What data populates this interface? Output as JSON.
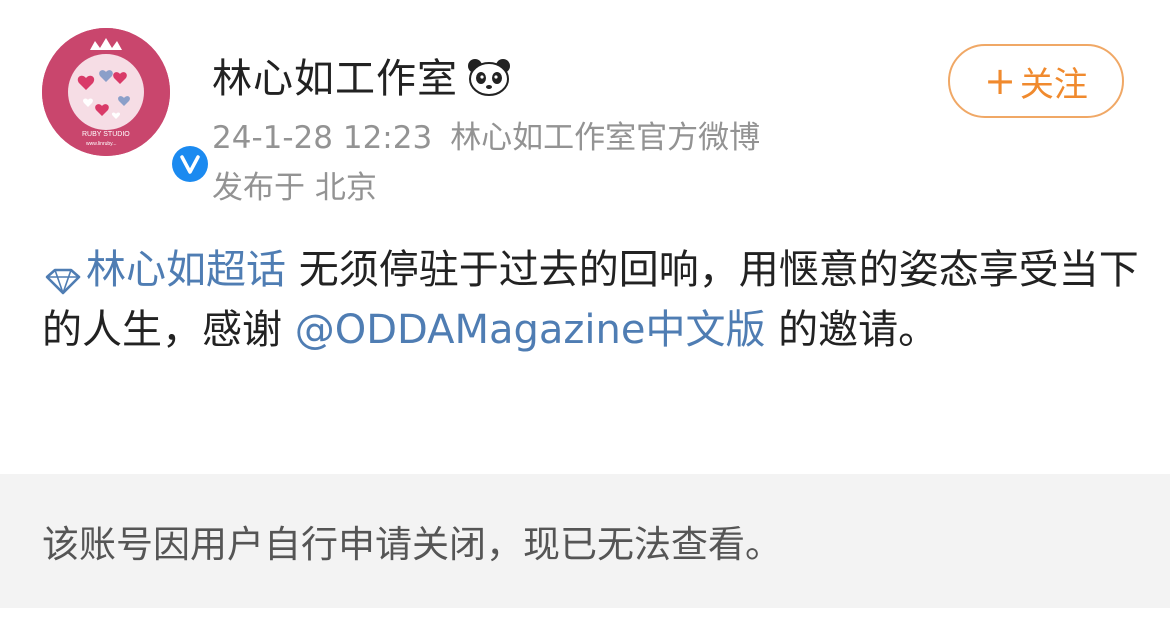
{
  "post": {
    "author": {
      "name": "林心如工作室",
      "name_icon": "panda-emoji",
      "avatar_text": "RUBY STUDIO",
      "avatar_url_text": "www.linruby...",
      "verified_icon": "verified-v-icon"
    },
    "timestamp": "24-1-28 12:23",
    "source": "林心如工作室官方微博",
    "location_prefix": "发布于",
    "location": "北京",
    "follow_button": {
      "plus": "+",
      "label": "关注"
    },
    "content": {
      "topic_icon": "supertopic-diamond-icon",
      "topic": "林心如超话",
      "text_1": " 无须停驻于过去的回响，用惬意的姿态享受当下的人生，感谢 ",
      "mention": "@ODDAMagazine中文版",
      "text_2": " 的邀请。"
    },
    "closed_notice": "该账号因用户自行申请关闭，现已无法查看。"
  },
  "colors": {
    "link": "#4f7db3",
    "follow_accent": "#f08a2e",
    "meta_gray": "#939393",
    "panel_bg": "#f3f3f3",
    "avatar_pink": "#c9466d",
    "verified_blue": "#1b8af0"
  }
}
